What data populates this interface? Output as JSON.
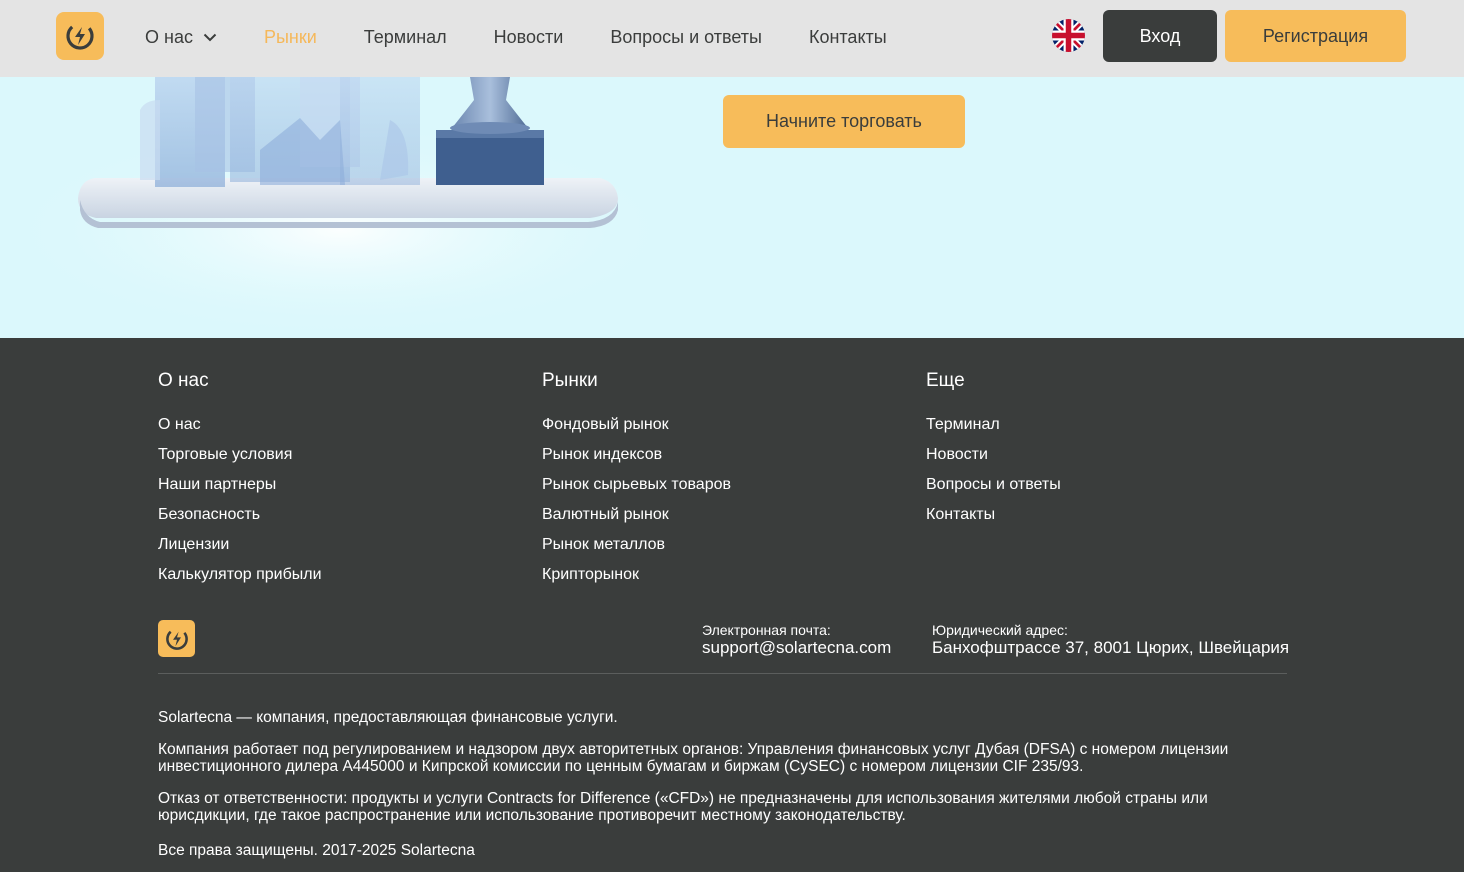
{
  "header": {
    "nav": [
      {
        "label": "О нас",
        "dropdown": true,
        "active": false
      },
      {
        "label": "Рынки",
        "dropdown": false,
        "active": true
      },
      {
        "label": "Терминал",
        "dropdown": false,
        "active": false
      },
      {
        "label": "Новости",
        "dropdown": false,
        "active": false
      },
      {
        "label": "Вопросы и ответы",
        "dropdown": false,
        "active": false
      },
      {
        "label": "Контакты",
        "dropdown": false,
        "active": false
      }
    ],
    "language_icon": "uk-flag-icon",
    "login_label": "Вход",
    "register_label": "Регистрация"
  },
  "hero": {
    "cta_label": "Начните торговать"
  },
  "footer": {
    "columns": [
      {
        "title": "О нас",
        "links": [
          "О нас",
          "Торговые условия",
          "Наши партнеры",
          "Безопасность",
          "Лицензии",
          "Калькулятор прибыли"
        ]
      },
      {
        "title": "Рынки",
        "links": [
          "Фондовый рынок",
          "Рынок индексов",
          "Рынок сырьевых товаров",
          "Валютный рынок",
          "Рынок металлов",
          "Крипторынок"
        ]
      },
      {
        "title": "Еще",
        "links": [
          "Терминал",
          "Новости",
          "Вопросы и ответы",
          "Контакты"
        ]
      }
    ],
    "email_label": "Электронная почта:",
    "email_value": "support@solartecna.com",
    "address_label": "Юридический адрес:",
    "address_value": "Банхофштрассе 37, 8001 Цюрих, Швейцария",
    "legal": [
      "Solartecna — компания, предоставляющая финансовые услуги.",
      "Компания работает под регулированием и надзором двух авторитетных органов: Управления финансовых услуг Дубая (DFSA) с номером лицензии инвестиционного дилера A445000 и Кипрской комиссии по ценным бумагам и биржам (CySEC) с номером лицензии CIF 235/93.",
      "Отказ от ответственности: продукты и услуги Contracts for Difference («CFD») не предназначены для использования жителями любой страны или юрисдикции, где такое распространение или использование противоречит местному законодательству.",
      "Все права защищены. 2017-2025 Solartecna"
    ]
  },
  "colors": {
    "accent": "#f7bc5a",
    "dark": "#3a3d3c",
    "header_bg": "#e4e4e4",
    "hero_bg": "#dbf8fc",
    "active_nav": "#f5b85a"
  }
}
